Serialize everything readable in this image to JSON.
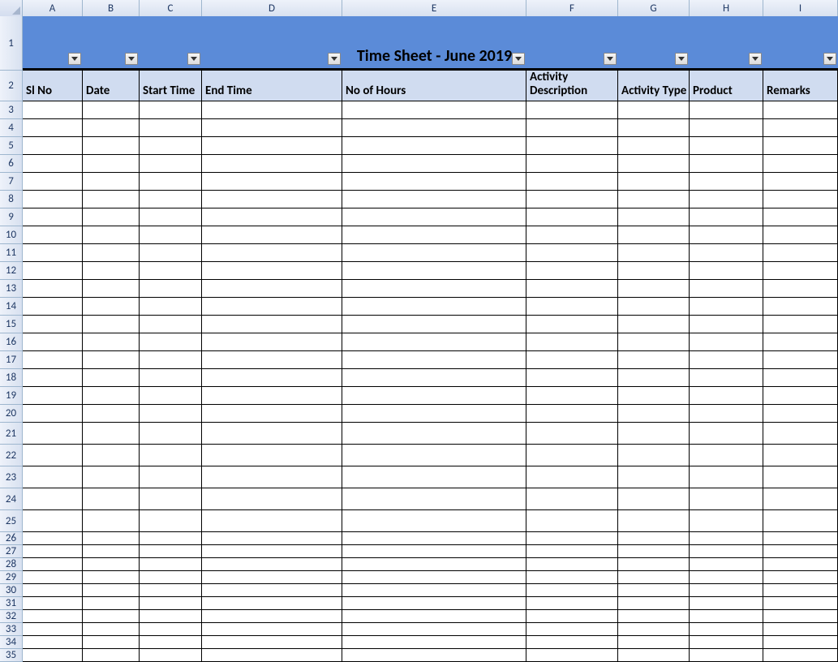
{
  "columns": [
    "A",
    "B",
    "C",
    "D",
    "E",
    "F",
    "G",
    "H",
    "I"
  ],
  "title": "Time Sheet - June 2019",
  "headers": {
    "A": "Sl No",
    "B": "Date",
    "C": "Start Time",
    "D": "End Time",
    "E": "No of Hours",
    "F_line1": "Activity",
    "F_line2": "Description",
    "G": "Activity Type",
    "H": "Product",
    "I": "Remarks"
  },
  "row_labels": [
    "1",
    "2",
    "3",
    "4",
    "5",
    "6",
    "7",
    "8",
    "9",
    "10",
    "11",
    "12",
    "13",
    "14",
    "15",
    "16",
    "17",
    "18",
    "19",
    "20",
    "21",
    "22",
    "23",
    "24",
    "25",
    "26",
    "27",
    "28",
    "29",
    "30",
    "31",
    "32",
    "33",
    "34",
    "35"
  ],
  "data_row_heights": {
    "tall_rows": [
      21,
      22,
      23,
      24,
      25
    ],
    "short_rows": [
      26,
      27,
      28,
      29,
      30,
      31,
      32,
      33,
      34,
      35
    ]
  }
}
